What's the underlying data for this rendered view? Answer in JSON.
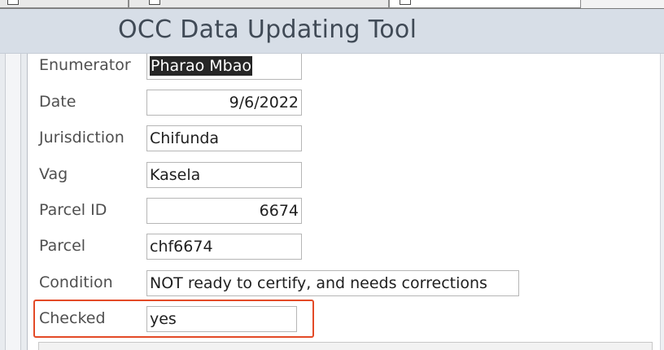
{
  "header": {
    "title": "OCC Data Updating Tool"
  },
  "tabs": [
    {
      "name": "tab-1",
      "active": false
    },
    {
      "name": "tab-2",
      "active": false
    },
    {
      "name": "tab-3",
      "active": true
    }
  ],
  "form": {
    "enumerator": {
      "label": "Enumerator",
      "value": "Pharao Mbao"
    },
    "date": {
      "label": "Date",
      "value": "9/6/2022"
    },
    "jurisdiction": {
      "label": "Jurisdiction",
      "value": "Chifunda"
    },
    "vag": {
      "label": "Vag",
      "value": "Kasela"
    },
    "parcel_id": {
      "label": "Parcel ID",
      "value": "6674"
    },
    "parcel": {
      "label": "Parcel",
      "value": "chf6674"
    },
    "condition": {
      "label": "Condition",
      "value": "NOT ready to certify, and needs corrections"
    },
    "checked": {
      "label": "Checked",
      "value": "yes"
    }
  },
  "colors": {
    "header_bg": "#d7dee7",
    "title_text": "#404a56",
    "highlight_border": "#e34a27",
    "selection_bg": "#262626"
  },
  "icons": [
    "form-tab-icon"
  ]
}
